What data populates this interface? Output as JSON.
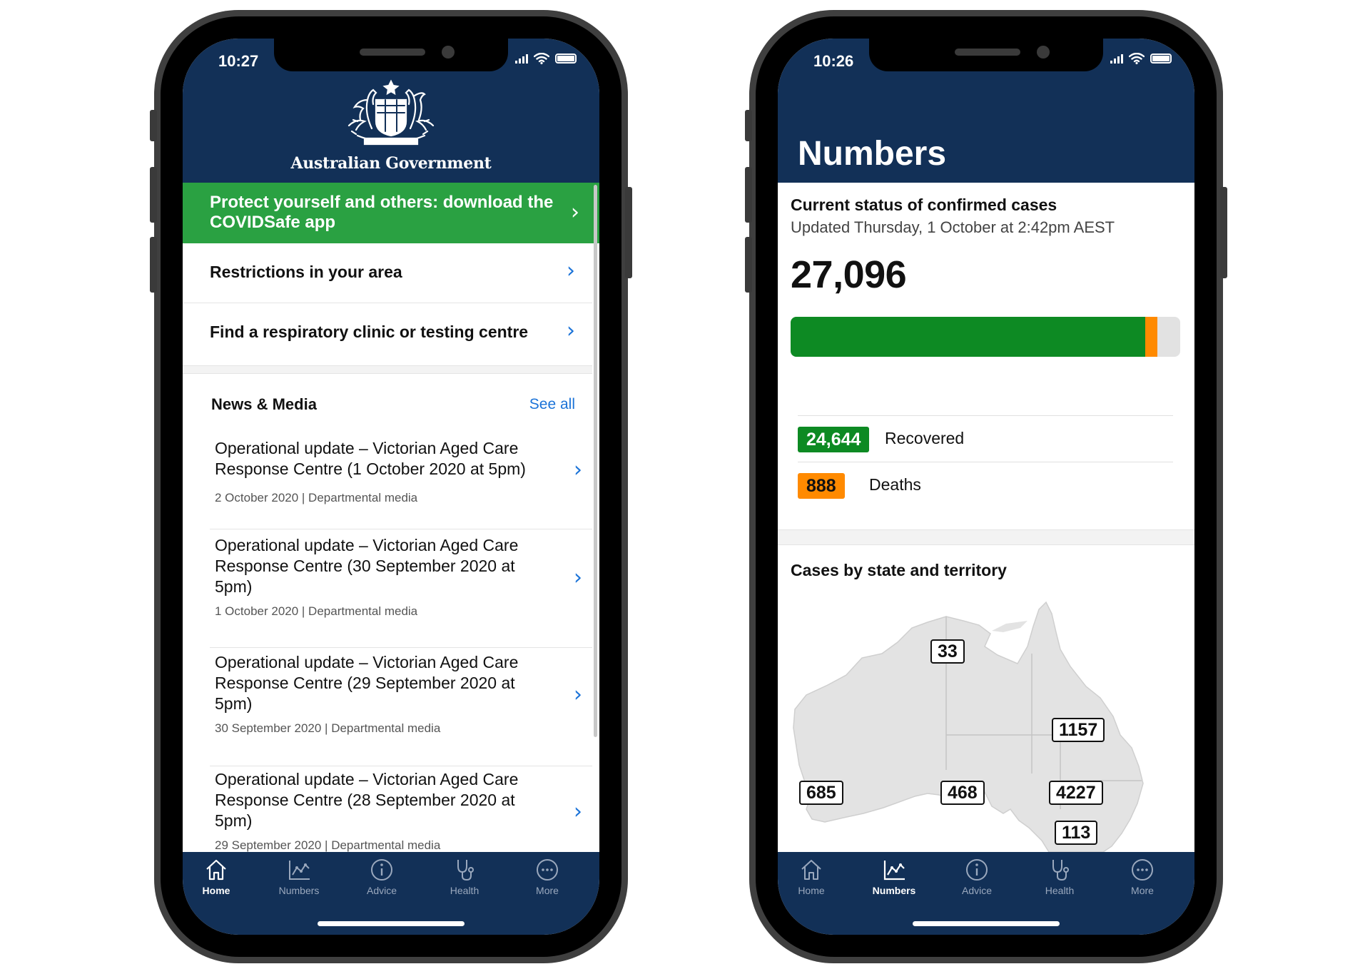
{
  "left_phone": {
    "status": {
      "time": "10:27"
    },
    "header": {
      "title": "Australian Government"
    },
    "promo": {
      "label": "Protect yourself and others: download the COVIDSafe app"
    },
    "menu": [
      {
        "label": "Restrictions in your area"
      },
      {
        "label": "Find a respiratory clinic or testing centre"
      }
    ],
    "news": {
      "title": "News & Media",
      "see_all": "See all",
      "items": [
        {
          "headline": "Operational update – Victorian Aged Care Response Centre (1 October 2020 at 5pm)",
          "meta": "2 October 2020 | Departmental media"
        },
        {
          "headline": "Operational update – Victorian Aged Care Response Centre (30 September 2020 at 5pm)",
          "meta": "1 October 2020 | Departmental media"
        },
        {
          "headline": "Operational update – Victorian Aged Care Response Centre (29 September 2020 at 5pm)",
          "meta": "30 September 2020 | Departmental media"
        },
        {
          "headline": "Operational update – Victorian Aged Care Response Centre (28 September 2020 at 5pm)",
          "meta": "29 September 2020 | Departmental media"
        }
      ]
    },
    "tabs": [
      {
        "label": "Home",
        "icon": "home-icon",
        "active": true
      },
      {
        "label": "Numbers",
        "icon": "chart-icon",
        "active": false
      },
      {
        "label": "Advice",
        "icon": "info-icon",
        "active": false
      },
      {
        "label": "Health",
        "icon": "stethoscope-icon",
        "active": false
      },
      {
        "label": "More",
        "icon": "more-icon",
        "active": false
      }
    ]
  },
  "right_phone": {
    "status": {
      "time": "10:26"
    },
    "header": {
      "title": "Numbers"
    },
    "status_section": {
      "heading": "Current status of confirmed cases",
      "updated": "Updated Thursday, 1 October at 2:42pm AEST",
      "total": "27,096",
      "recovered": {
        "value": "24,644",
        "label": "Recovered"
      },
      "deaths": {
        "value": "888",
        "label": "Deaths"
      },
      "bar_fractions": {
        "recovered": 0.9095,
        "deaths": 0.0328
      }
    },
    "map_section": {
      "title": "Cases by state and territory",
      "labels": {
        "nt": "33",
        "qld": "1157",
        "wa": "685",
        "sa": "468",
        "nsw": "4227",
        "act": "113"
      }
    },
    "tabs": [
      {
        "label": "Home",
        "icon": "home-icon",
        "active": false
      },
      {
        "label": "Numbers",
        "icon": "chart-icon",
        "active": true
      },
      {
        "label": "Advice",
        "icon": "info-icon",
        "active": false
      },
      {
        "label": "Health",
        "icon": "stethoscope-icon",
        "active": false
      },
      {
        "label": "More",
        "icon": "more-icon",
        "active": false
      }
    ]
  },
  "colors": {
    "navy": "#123057",
    "green_banner": "#2aa142",
    "recovered_green": "#0d8a23",
    "deaths_orange": "#ff8a00",
    "link_blue": "#1b73d8"
  }
}
